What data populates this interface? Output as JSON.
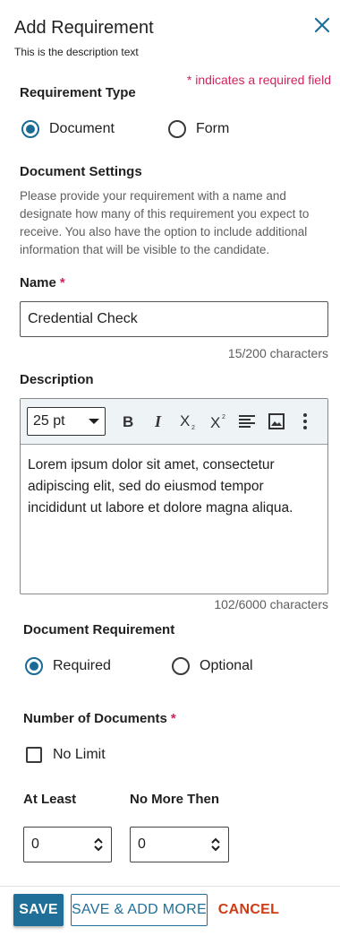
{
  "header": {
    "title": "Add Requirement",
    "subtitle": "This is the description text",
    "close_icon": "close-icon",
    "required_note": "* indicates a required field"
  },
  "requirement_type": {
    "label": "Requirement Type",
    "options": [
      {
        "label": "Document",
        "checked": true
      },
      {
        "label": "Form",
        "checked": false
      }
    ]
  },
  "document_settings": {
    "label": "Document Settings",
    "help": "Please provide your requirement with a name and designate how many of this requirement you expect to receive. You also have the option to include additional information that will be visible to the candidate."
  },
  "name": {
    "label": "Name",
    "required_mark": "*",
    "value": "Credential Check",
    "counter": "15/200 characters"
  },
  "description": {
    "label": "Description",
    "font_size": "25 pt",
    "toolbar_icons": [
      "bold-icon",
      "italic-icon",
      "subscript-icon",
      "superscript-icon",
      "align-icon",
      "image-icon",
      "more-vertical-icon"
    ],
    "body": "Lorem ipsum dolor sit amet, consectetur adipiscing elit, sed do eiusmod tempor incididunt ut labore et dolore magna aliqua.",
    "counter": "102/6000 characters"
  },
  "document_requirement": {
    "label": "Document Requirement",
    "options": [
      {
        "label": "Required",
        "checked": true
      },
      {
        "label": "Optional",
        "checked": false
      }
    ]
  },
  "number_of_documents": {
    "label": "Number of Documents",
    "required_mark": "*",
    "no_limit_label": "No Limit",
    "no_limit_checked": false,
    "at_least_label": "At Least",
    "at_least_value": "0",
    "no_more_label": "No More Then",
    "no_more_value": "0"
  },
  "footer": {
    "save": "SAVE",
    "save_add_more": "SAVE & ADD MORE",
    "cancel": "CANCEL"
  },
  "colors": {
    "accent": "#1f6f98",
    "required": "#d0245b",
    "cancel": "#cc3d15"
  }
}
